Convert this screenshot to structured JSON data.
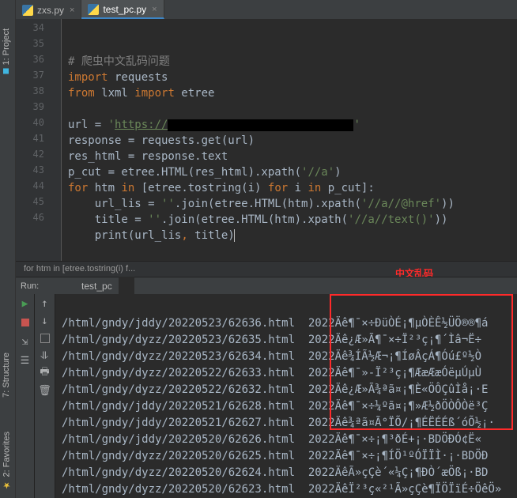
{
  "tabs": [
    {
      "label": "zxs.py",
      "active": false
    },
    {
      "label": "test_pc.py",
      "active": true
    }
  ],
  "vertical_tabs": {
    "project": "1: Project",
    "structure": "7: Structure",
    "favorites": "2: Favorites"
  },
  "gutter_lines": [
    "34",
    "35",
    "36",
    "37",
    "38",
    "39",
    "40",
    "41",
    "42",
    "43",
    "44",
    "45",
    "46"
  ],
  "code_tokens": {
    "l35_hash": "#",
    "l35_comment": " 爬虫中文乱码问题",
    "l36_import": "import",
    "l36_mod": " requests",
    "l37_from": "from",
    "l37_mid": " lxml ",
    "l37_import": "import",
    "l37_mod": " etree",
    "l39_pre": "url = ",
    "l39_q": "'",
    "l39_url": "https://",
    "l40": "response = requests.get(url)",
    "l41": "res_html = response.text",
    "l42_pre": "p_cut = etree.HTML(res_html).xpath(",
    "l42_str": "'//a'",
    "l42_post": ")",
    "l43_for": "for",
    "l43_mid1": " htm ",
    "l43_in1": "in",
    "l43_mid2": " [etree.tostring(i) ",
    "l43_for2": "for",
    "l43_mid3": " i ",
    "l43_in2": "in",
    "l43_mid4": " p_cut]:",
    "l44_pre": "    url_lis = ",
    "l44_str1": "''",
    "l44_mid": ".join(etree.HTML(htm).xpath(",
    "l44_str2": "'//a//@href'",
    "l44_post": "))",
    "l45_pre": "    title = ",
    "l45_str1": "''",
    "l45_mid": ".join(etree.HTML(htm).xpath(",
    "l45_str2": "'//a//text()'",
    "l45_post": "))",
    "l46_pre": "    ",
    "l46_fn": "print",
    "l46_open": "(url_lis",
    "l46_comma": ",",
    "l46_post": " title)"
  },
  "breadcrumb": "for htm in [etree.tostring(i) f...",
  "annotation": "中文乱码",
  "run": {
    "header": "Run:",
    "tab": "test_pc"
  },
  "output_lines": [
    "/html/gndy/jddy/20220523/62636.html  2022Äê¶¯×÷ÐüÒÉ¡¶µÒÈÊ½ÜÖ®®¶á",
    "/html/gndy/dyzz/20220523/62635.html  2022Äê¿Æ»Ã¶¯×÷Ï²³ç¡¶´Ìâ¬Ë÷",
    "/html/gndy/dyzz/20220523/62634.html  2022Äê¾ÍÃ½Æ¬¡¶ÍøÂçÁ¶Óú£º½Ò",
    "/html/gndy/dyzz/20220522/62633.html  2022Äê¶¯»-Ï²³ç¡¶ÆæÆæÓëµÚµÙ",
    "/html/gndy/dyzz/20220522/62632.html  2022Äê¿Æ»Ã¾ªã¤¡¶È«ÖÔÇûÌå¡·E",
    "/html/gndy/jddy/20220521/62628.html  2022Äê¶¯×÷¼ºã¤¡¶»Æ½ðÖÒÔÒë³Ç",
    "/html/gndy/jddy/20220521/62627.html  2022Äê¾ªã¤Ã°ÏÕ/¡¶ÉËÉÉß´óÕ½¡·",
    "/html/gndy/jddy/20220520/62626.html  2022Äê¶¯×÷¡¶³ðÉ+¡·BDÖÐÓ¢Ë«",
    "/html/gndy/dyzz/20220520/62625.html  2022Äê¶¯×÷¡¶ÍÖ¹ºÓÏÏÌ·¡·BDÖÐ",
    "/html/gndy/dyzz/20220520/62624.html  2022ÄêÃ»çÇè´«¼Ç¡¶ÐÒ´æÖß¡·BD",
    "/html/gndy/dyzz/20220520/62623.html  2022ÄêÏ²³ç«²¹Ã»çÇè¶ÏÖÏïÉ÷ÖêÖ»"
  ]
}
